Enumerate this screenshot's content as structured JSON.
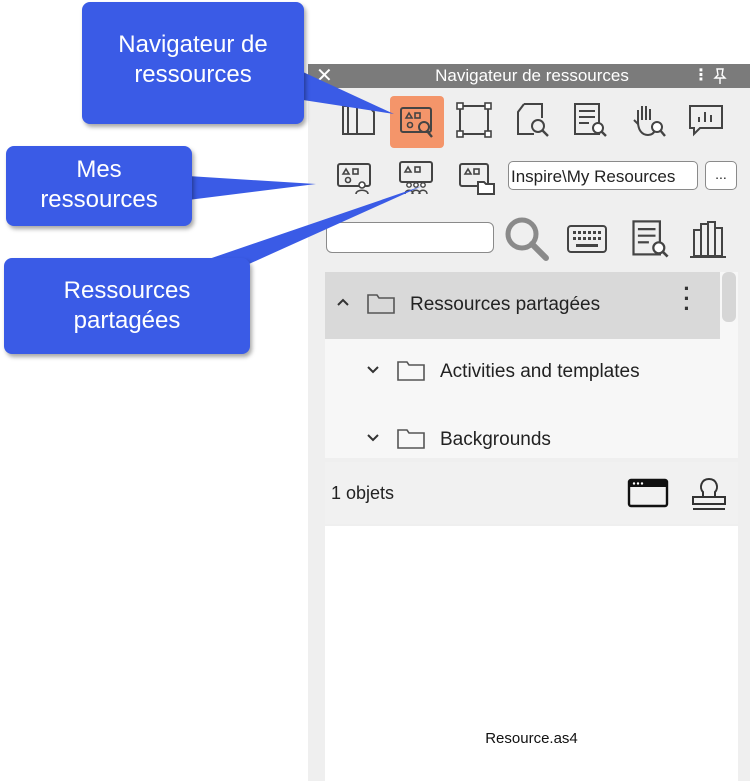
{
  "panel": {
    "title": "Navigateur de ressources",
    "close_icon": "close-icon",
    "menu_glyph": "⋮"
  },
  "toolbar_row1": [
    {
      "name": "flipchart-pages-tool",
      "icon": "pages-icon",
      "active": false
    },
    {
      "name": "resource-browser-tool",
      "icon": "resource-browser-icon",
      "active": true
    },
    {
      "name": "property-browser-tool",
      "icon": "property-icon",
      "active": false
    },
    {
      "name": "object-browser-tool",
      "icon": "object-browser-icon",
      "active": false
    },
    {
      "name": "notes-browser-tool",
      "icon": "notes-browser-icon",
      "active": false
    },
    {
      "name": "action-browser-tool",
      "icon": "action-browser-icon",
      "active": false
    },
    {
      "name": "voting-browser-tool",
      "icon": "voting-browser-icon",
      "active": false
    }
  ],
  "toolbar_row2": {
    "path": "Inspire\\My Resources",
    "more_label": "..."
  },
  "tree": [
    {
      "label": "Ressources partagées",
      "expanded": true,
      "selected": true
    },
    {
      "label": "Activities and templates",
      "expanded": false,
      "selected": false
    },
    {
      "label": "Backgrounds",
      "expanded": false,
      "selected": false
    }
  ],
  "status": {
    "count": "1 objets"
  },
  "preview": {
    "file_name": "Resource.as4"
  },
  "callouts": {
    "navigator": "Navigateur de ressources",
    "mine": "Mes ressources",
    "shared": "Ressources partagées"
  },
  "colors": {
    "callout": "#3a5be6",
    "active_tool": "#f4956a",
    "titlebar": "#7b7b7b"
  }
}
